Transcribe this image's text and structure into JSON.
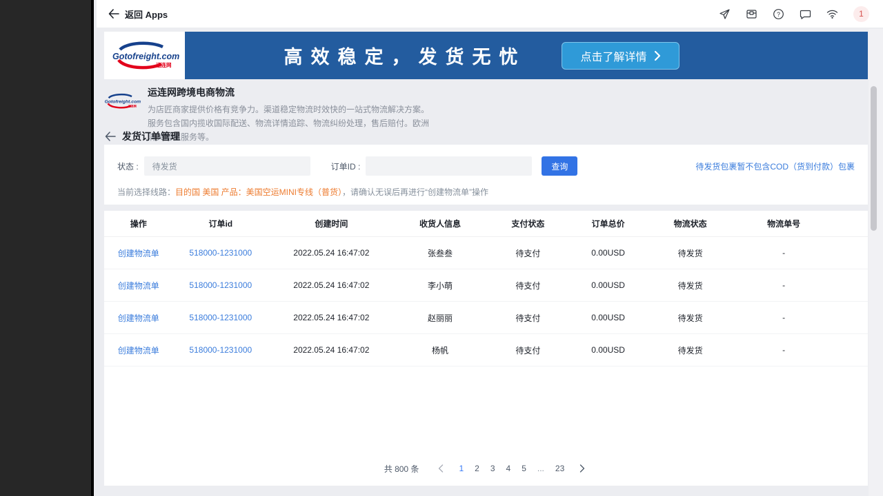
{
  "topbar": {
    "back_label": "返回 Apps",
    "badge_count": "1"
  },
  "banner": {
    "logo_text": "Gotofreight.com",
    "logo_sub": "运连网",
    "headline": "高效稳定，发货无忧",
    "cta_label": "点击了解详情"
  },
  "intro": {
    "title": "运连网跨境电商物流",
    "description": "为店匠商家提供价格有竞争力。渠道稳定物流时效快的一站式物流解决方案。服务包含国内揽收国际配送、物流详情追踪、物流纠纷处理，售后赔付。欧洲清关增值服务等。"
  },
  "page": {
    "title": "发货订单管理"
  },
  "filters": {
    "status_label": "状态 :",
    "status_value": "待发货",
    "order_id_label": "订单ID :",
    "order_id_value": "",
    "search_label": "查询",
    "notice_link": "待发货包裹暂不包含COD（货到付款）包裹",
    "route_prefix": "当前选择线路：",
    "route_highlight": "目的国 美国 产品：美国空运MINI专线（普货）",
    "route_suffix": "，请确认无误后再进行“创建物流单”操作"
  },
  "table": {
    "headers": [
      "操作",
      "订单id",
      "创建时间",
      "收货人信息",
      "支付状态",
      "订单总价",
      "物流状态",
      "物流单号"
    ],
    "rows": [
      {
        "action": "创建物流单",
        "order_id": "518000-1231000",
        "created_at": "2022.05.24 16:47:02",
        "receiver": "张叁叁",
        "pay_status": "待支付",
        "total": "0.00USD",
        "logistics_status": "待发货",
        "tracking_no": "-"
      },
      {
        "action": "创建物流单",
        "order_id": "518000-1231000",
        "created_at": "2022.05.24 16:47:02",
        "receiver": "李小萌",
        "pay_status": "待支付",
        "total": "0.00USD",
        "logistics_status": "待发货",
        "tracking_no": "-"
      },
      {
        "action": "创建物流单",
        "order_id": "518000-1231000",
        "created_at": "2022.05.24 16:47:02",
        "receiver": "赵丽丽",
        "pay_status": "待支付",
        "total": "0.00USD",
        "logistics_status": "待发货",
        "tracking_no": "-"
      },
      {
        "action": "创建物流单",
        "order_id": "518000-1231000",
        "created_at": "2022.05.24 16:47:02",
        "receiver": "杨帆",
        "pay_status": "待支付",
        "total": "0.00USD",
        "logistics_status": "待发货",
        "tracking_no": "-"
      }
    ]
  },
  "pagination": {
    "total_label": "共 800 条",
    "pages": [
      "1",
      "2",
      "3",
      "4",
      "5",
      "...",
      "23"
    ],
    "active_page": "1",
    "ellipsis": "..."
  },
  "colors": {
    "banner_blue": "#235c9f",
    "cta_blue": "#2f9ad8",
    "accent_blue": "#3273e5",
    "link_blue": "#3a7cdc",
    "route_orange": "#ed7b2f",
    "badge_red": "#d5504c",
    "logo_navy": "#16418c",
    "logo_red": "#e2001a"
  }
}
